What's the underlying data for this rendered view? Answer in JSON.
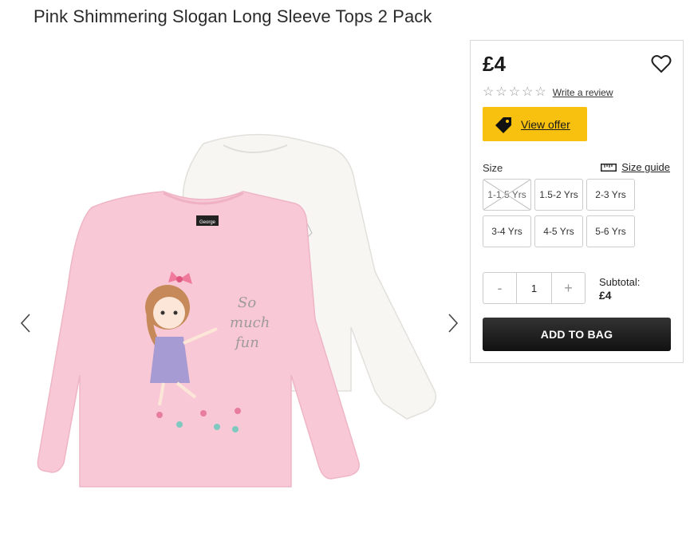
{
  "product": {
    "title": "Pink Shimmering Slogan Long Sleeve Tops 2 Pack",
    "image_text": {
      "brand_label": "George",
      "slogan_line1": "So",
      "slogan_line2": "much",
      "slogan_line3": "fun"
    }
  },
  "panel": {
    "price": "£4",
    "rating": {
      "stars_filled": 0,
      "stars_total": 5,
      "review_link": "Write a review"
    },
    "offer_button": "View offer",
    "size_label": "Size",
    "size_guide": "Size guide",
    "sizes": [
      {
        "label": "1-1.5 Yrs",
        "available": false
      },
      {
        "label": "1.5-2 Yrs",
        "available": true
      },
      {
        "label": "2-3 Yrs",
        "available": true
      },
      {
        "label": "3-4 Yrs",
        "available": true
      },
      {
        "label": "4-5 Yrs",
        "available": true
      },
      {
        "label": "5-6 Yrs",
        "available": true
      }
    ],
    "quantity": {
      "minus": "-",
      "value": "1",
      "plus": "+"
    },
    "subtotal_label": "Subtotal:",
    "subtotal_value": "£4",
    "add_to_bag": "ADD TO BAG"
  },
  "colors": {
    "offer_yellow": "#f8c10f",
    "button_dark": "#1a1a1a",
    "shirt_pink": "#f9c8d6",
    "shirt_white": "#f7f6f3"
  },
  "icons": {
    "prev": "chevron-left-icon",
    "next": "chevron-right-icon",
    "wishlist": "heart-icon",
    "offer": "tag-icon",
    "size_guide": "ruler-icon",
    "star": "star-outline-icon"
  }
}
